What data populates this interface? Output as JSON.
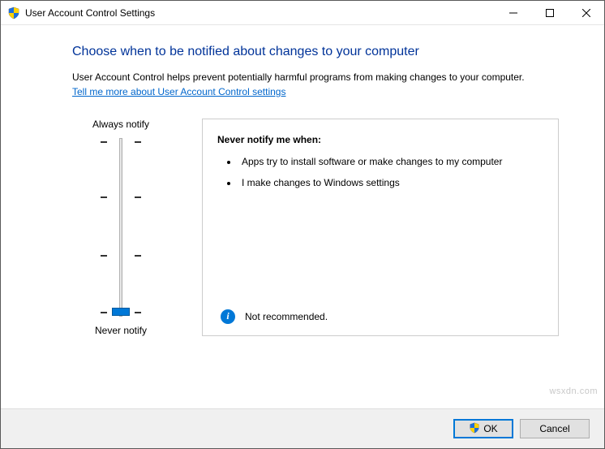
{
  "window": {
    "title": "User Account Control Settings"
  },
  "content": {
    "heading": "Choose when to be notified about changes to your computer",
    "description": "User Account Control helps prevent potentially harmful programs from making changes to your computer.",
    "link": "Tell me more about User Account Control settings"
  },
  "slider": {
    "top_label": "Always notify",
    "bottom_label": "Never notify",
    "levels": 4,
    "current_level": 0
  },
  "panel": {
    "heading": "Never notify me when:",
    "bullets": [
      "Apps try to install software or make changes to my computer",
      "I make changes to Windows settings"
    ],
    "recommendation": "Not recommended."
  },
  "buttons": {
    "ok": "OK",
    "cancel": "Cancel"
  },
  "watermark": "wsxdn.com"
}
